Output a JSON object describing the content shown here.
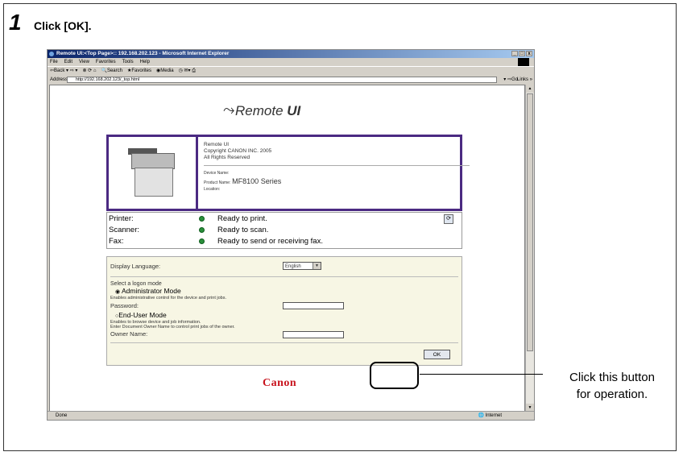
{
  "step": {
    "number": "1",
    "instruction": "Click [OK]."
  },
  "browser": {
    "title": "Remote UI:<Top Page>:: 192.168.202.123 - Microsoft Internet Explorer",
    "menu": [
      "File",
      "Edit",
      "View",
      "Favorites",
      "Tools",
      "Help"
    ],
    "toolbar": [
      "Back",
      "Search",
      "Favorites",
      "Media"
    ],
    "address_label": "Address",
    "address_value": "http://192.168.202.123/_top.html",
    "go_label": "Go",
    "links_label": "Links »",
    "status_done": "Done",
    "status_zone": "Internet"
  },
  "remote_ui": {
    "title_a": "Remote ",
    "title_b": "UI",
    "info_line1": "Remote UI",
    "info_line2": "Copyright CANON INC. 2005",
    "info_line3": "All Rights Reserved",
    "device_name_label": "Device Name:",
    "product_name_label": "Product Name:",
    "product_name_value": "MF8100 Series",
    "location_label": "Location:",
    "status": [
      {
        "label": "Printer:",
        "value": "Ready to print."
      },
      {
        "label": "Scanner:",
        "value": "Ready to scan."
      },
      {
        "label": "Fax:",
        "value": "Ready to send or receiving fax."
      }
    ],
    "display_language_label": "Display Language:",
    "display_language_value": "English",
    "logon_mode_label": "Select a logon mode",
    "admin_mode_label": "Administrator Mode",
    "admin_mode_desc": "Enables administrative control for the device and print jobs.",
    "password_label": "Password:",
    "enduser_mode_label": "End-User Mode",
    "enduser_desc1": "Enables to browse device and job information.",
    "enduser_desc2": "Enter Document Owner Name to control print jobs of the owner.",
    "owner_name_label": "Owner Name:",
    "ok_label": "OK",
    "brand": "Canon"
  },
  "callout": {
    "line1": "Click this button",
    "line2": "for operation."
  }
}
